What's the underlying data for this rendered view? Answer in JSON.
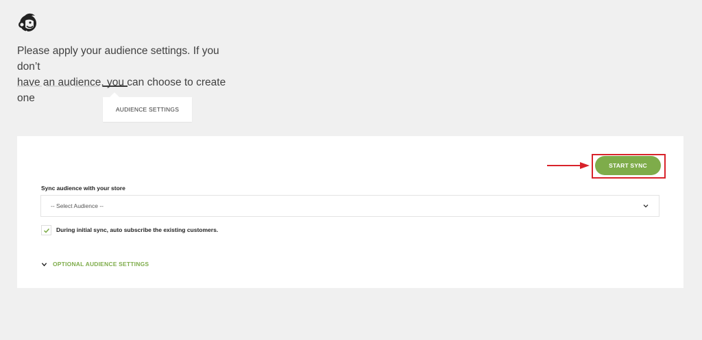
{
  "logo": {
    "icon": "mailchimp-freddie-icon"
  },
  "intro": {
    "line1": "Please apply your audience settings. If you don’t",
    "line2": "have an audience, you can choose to create one"
  },
  "steps": {
    "count": 4,
    "active_index": 3
  },
  "tooltip": {
    "label": "AUDIENCE SETTINGS"
  },
  "card": {
    "start_sync_label": "START SYNC",
    "sync_label": "Sync audience with your store",
    "select": {
      "value": "-- Select Audience --",
      "icon": "chevron-down-icon"
    },
    "auto_subscribe": {
      "checked": true,
      "label": "During initial sync, auto subscribe the existing customers."
    },
    "optional_settings": {
      "label": "OPTIONAL AUDIENCE SETTINGS",
      "icon": "chevron-down-icon"
    }
  },
  "annotation": {
    "arrow_color": "#d8222a",
    "highlight_color": "#d8222a"
  },
  "colors": {
    "accent": "#7eac4a",
    "background": "#f0f0f0"
  }
}
